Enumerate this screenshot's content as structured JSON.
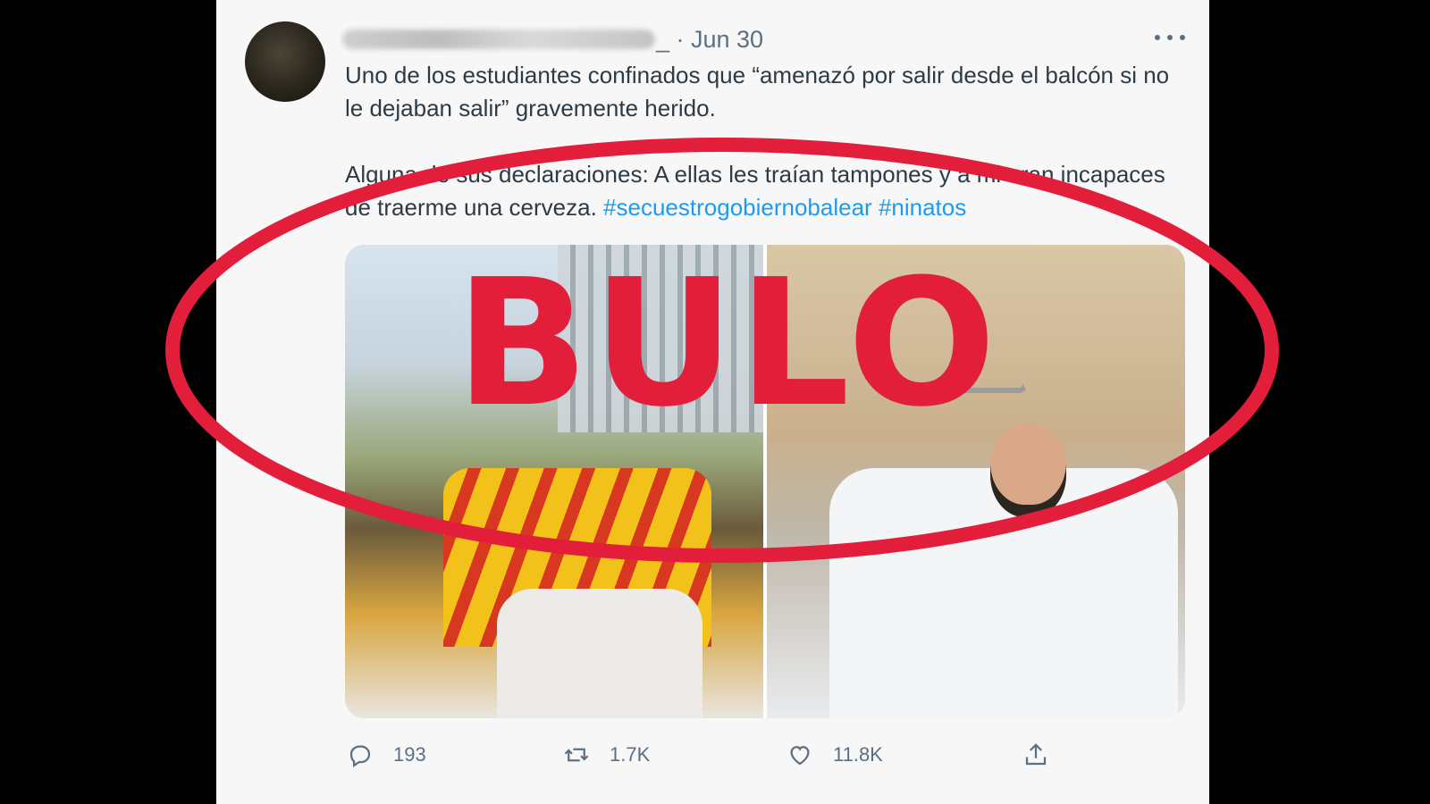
{
  "tweet": {
    "date_line": "_ · Jun 30",
    "text_line1": "Uno de los estudiantes confinados que “amenazó por salir desde el balcón si no le dejaban salir” gravemente herido.",
    "text_line2_plain": "Alguna de sus declaraciones: A ellas les traían tampones y a mi eran incapaces de traerme una cerveza. ",
    "hashtag1": "#secuestrogobiernobalear",
    "hashtag2": "#ninatos",
    "more_icon": "more-dots-icon"
  },
  "actions": {
    "replies": "193",
    "retweets": "1.7K",
    "likes": "11.8K"
  },
  "stamp": {
    "label": "BULO",
    "color": "#e21e3a"
  },
  "colors": {
    "background": "#000000",
    "card": "#f7f7f7",
    "text": "#2d3b47",
    "muted": "#5b7083",
    "link": "#1d9bf0"
  }
}
